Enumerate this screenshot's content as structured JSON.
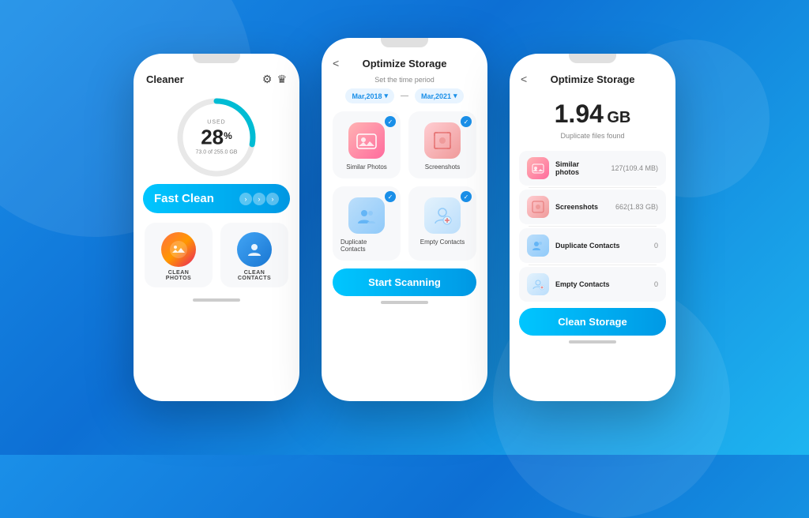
{
  "background": {
    "colors": [
      "#1a8fe8",
      "#0d6fd4",
      "#1eb5f0"
    ]
  },
  "phone1": {
    "title": "Cleaner",
    "icons": [
      "⚙",
      "♛"
    ],
    "gauge": {
      "used_label": "USED",
      "percent": "28",
      "pct_symbol": "%",
      "sub_label": "73.0 of 255.0 GB"
    },
    "fast_clean_btn": "Fast Clean",
    "arrows": ">>>",
    "options": [
      {
        "label": "CLEAN\nPHOTOS",
        "icon_type": "photos"
      },
      {
        "label": "CLEAN\nCONTACTS",
        "icon_type": "contacts"
      }
    ]
  },
  "phone2": {
    "back": "<",
    "title": "Optimize Storage",
    "time_period_label": "Set the time period",
    "from_date": "Mar,2018",
    "to_date": "Mar,2021",
    "separator": "—",
    "scan_items": [
      {
        "label": "Similar Photos",
        "checked": true,
        "icon_type": "photos"
      },
      {
        "label": "Screenshots",
        "checked": true,
        "icon_type": "screenshots"
      },
      {
        "label": "Duplicate Contacts",
        "checked": true,
        "icon_type": "dupcontacts"
      },
      {
        "label": "Empty Contacts",
        "checked": true,
        "icon_type": "emptycontacts"
      }
    ],
    "start_btn": "Start Scanning"
  },
  "phone3": {
    "back": "<",
    "title": "Optimize Storage",
    "storage_size": "1.94",
    "storage_unit": "GB",
    "storage_sub": "Duplicate files found",
    "rows": [
      {
        "name": "Similar photos",
        "count": "127(109.4 MB)",
        "icon_type": "photos"
      },
      {
        "name": "Screenshots",
        "count": "662(1.83 GB)",
        "icon_type": "screenshots"
      },
      {
        "name": "Duplicate Contacts",
        "count": "0",
        "icon_type": "dupcontacts"
      },
      {
        "name": "Empty Contacts",
        "count": "0",
        "icon_type": "emptycontacts"
      }
    ],
    "clean_btn": "Clean Storage"
  }
}
